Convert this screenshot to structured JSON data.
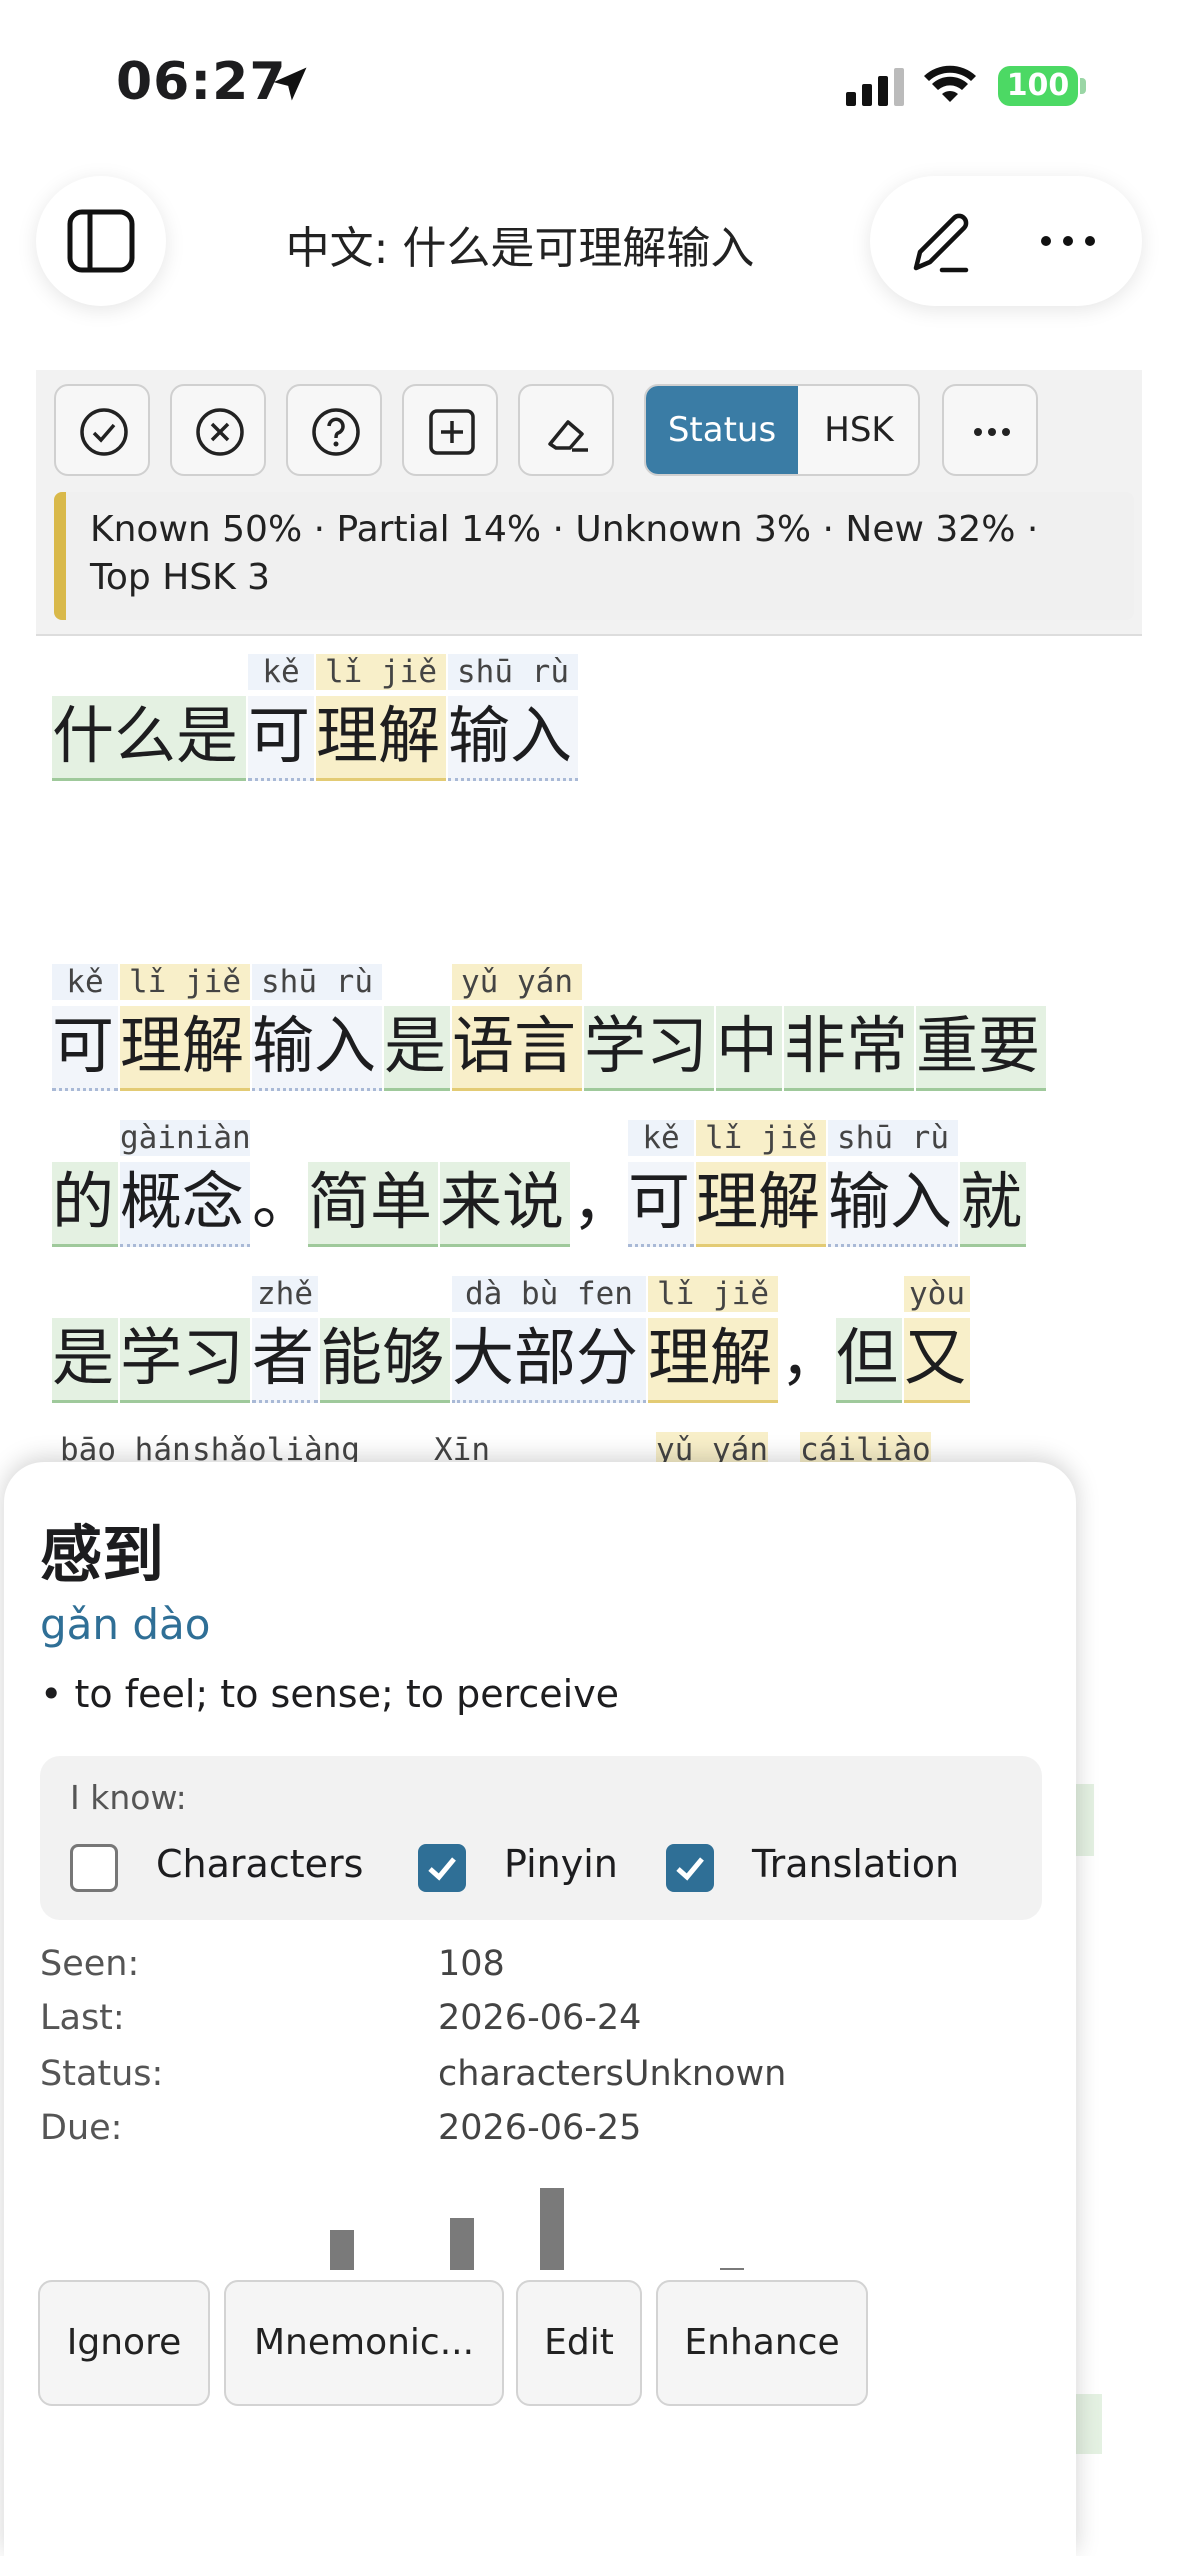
{
  "status_bar": {
    "time": "06:27",
    "battery": "100"
  },
  "header": {
    "title": "中文: 什么是可理解输入"
  },
  "toolbar": {
    "seg_status": "Status",
    "seg_hsk": "HSK",
    "stats_line1": "Known 50% · Partial 14% · Unknown 3% · New 32% ·",
    "stats_line2": "Top HSK 3"
  },
  "text": {
    "title_words": [
      {
        "hz": "什么是",
        "py": "",
        "cls": "known"
      },
      {
        "hz": "可",
        "py": "kě",
        "cls": "unknown"
      },
      {
        "hz": "理解",
        "py": "lǐ jiě",
        "cls": "partial"
      },
      {
        "hz": "输入",
        "py": "shū rù",
        "cls": "unknown"
      }
    ],
    "line1": [
      {
        "hz": "可",
        "py": "kě",
        "cls": "unknown"
      },
      {
        "hz": "理解",
        "py": "lǐ jiě",
        "cls": "partial"
      },
      {
        "hz": "输入",
        "py": "shū rù",
        "cls": "unknown"
      },
      {
        "hz": "是",
        "py": "",
        "cls": "known"
      },
      {
        "hz": "语言",
        "py": "yǔ yán",
        "cls": "partial"
      },
      {
        "hz": "学习",
        "py": "",
        "cls": "known"
      },
      {
        "hz": "中",
        "py": "",
        "cls": "known"
      },
      {
        "hz": "非常",
        "py": "",
        "cls": "known"
      },
      {
        "hz": "重要",
        "py": "",
        "cls": "known"
      }
    ],
    "line2": [
      {
        "hz": "的",
        "py": "",
        "cls": "known"
      },
      {
        "hz": "概念",
        "py": "gàiniàn",
        "cls": "newc"
      },
      {
        "hz": "。",
        "py": "",
        "cls": "punct"
      },
      {
        "hz": "简单",
        "py": "",
        "cls": "known"
      },
      {
        "hz": "来说",
        "py": "",
        "cls": "known"
      },
      {
        "hz": "，",
        "py": "",
        "cls": "punct"
      },
      {
        "hz": "可",
        "py": "kě",
        "cls": "unknown"
      },
      {
        "hz": "理解",
        "py": "lǐ jiě",
        "cls": "partial"
      },
      {
        "hz": "输入",
        "py": "shū rù",
        "cls": "unknown"
      },
      {
        "hz": "就",
        "py": "",
        "cls": "known"
      }
    ],
    "line3": [
      {
        "hz": "是",
        "py": "",
        "cls": "known"
      },
      {
        "hz": "学习",
        "py": "",
        "cls": "known"
      },
      {
        "hz": "者",
        "py": "zhě",
        "cls": "unknown"
      },
      {
        "hz": "能够",
        "py": "",
        "cls": "known"
      },
      {
        "hz": "大部分",
        "py": "dà bù fen",
        "cls": "newc"
      },
      {
        "hz": "理解",
        "py": "lǐ jiě",
        "cls": "partial"
      },
      {
        "hz": "，",
        "py": "",
        "cls": "punct"
      },
      {
        "hz": "但",
        "py": "",
        "cls": "known"
      },
      {
        "hz": "又",
        "py": "yòu",
        "cls": "partial"
      }
    ],
    "line4_pinyin": [
      "bāo hán",
      "shǎoliàng",
      "Xīn",
      "yǔ yán",
      "cáiliào"
    ]
  },
  "popup": {
    "word": "感到",
    "pinyin": "gǎn dào",
    "definition": "• to feel; to sense; to perceive",
    "iknow_label": "I know:",
    "checks": [
      {
        "label": "Characters",
        "checked": false
      },
      {
        "label": "Pinyin",
        "checked": true
      },
      {
        "label": "Translation",
        "checked": true
      }
    ],
    "meta": [
      {
        "key": "Seen:",
        "value": "108"
      },
      {
        "key": "Last:",
        "value": "2026-06-24"
      },
      {
        "key": "Status:",
        "value": "charactersUnknown"
      },
      {
        "key": "Due:",
        "value": "2026-06-25"
      }
    ],
    "buttons": [
      "Ignore",
      "Mnemonic...",
      "Edit",
      "Enhance"
    ]
  },
  "colors": {
    "accent": "#3a7ca5",
    "known_bg": "#e4f1e2",
    "partial_bg": "#f8efc9",
    "new_bg": "#eef3fa",
    "battery": "#4cd964"
  }
}
